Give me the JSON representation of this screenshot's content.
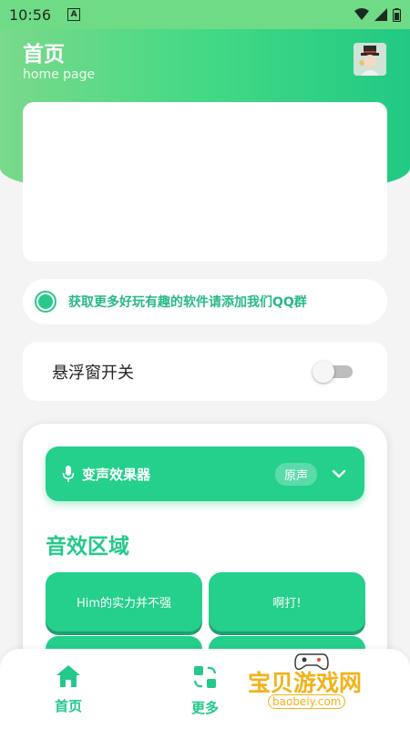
{
  "status_bar": {
    "time": "10:56",
    "app_letter": "A"
  },
  "header": {
    "title": "首页",
    "subtitle": "home page"
  },
  "notice": {
    "text": "获取更多好玩有趣的软件请添加我们QQ群"
  },
  "float_window": {
    "label": "悬浮窗开关",
    "enabled": false
  },
  "effect": {
    "label": "变声效果器",
    "selected": "原声"
  },
  "sound_area": {
    "title": "音效区域",
    "buttons": [
      "Him的实力并不强",
      "啊打!",
      "",
      ""
    ]
  },
  "nav": [
    {
      "label": "首页",
      "icon": "home-icon"
    },
    {
      "label": "更多",
      "icon": "apps-icon"
    }
  ],
  "watermark": {
    "text": "宝贝游戏网",
    "sub": "baobeiy.com"
  },
  "colors": {
    "accent": "#25cf8c",
    "header_start": "#7ad98a",
    "header_end": "#21c984"
  }
}
